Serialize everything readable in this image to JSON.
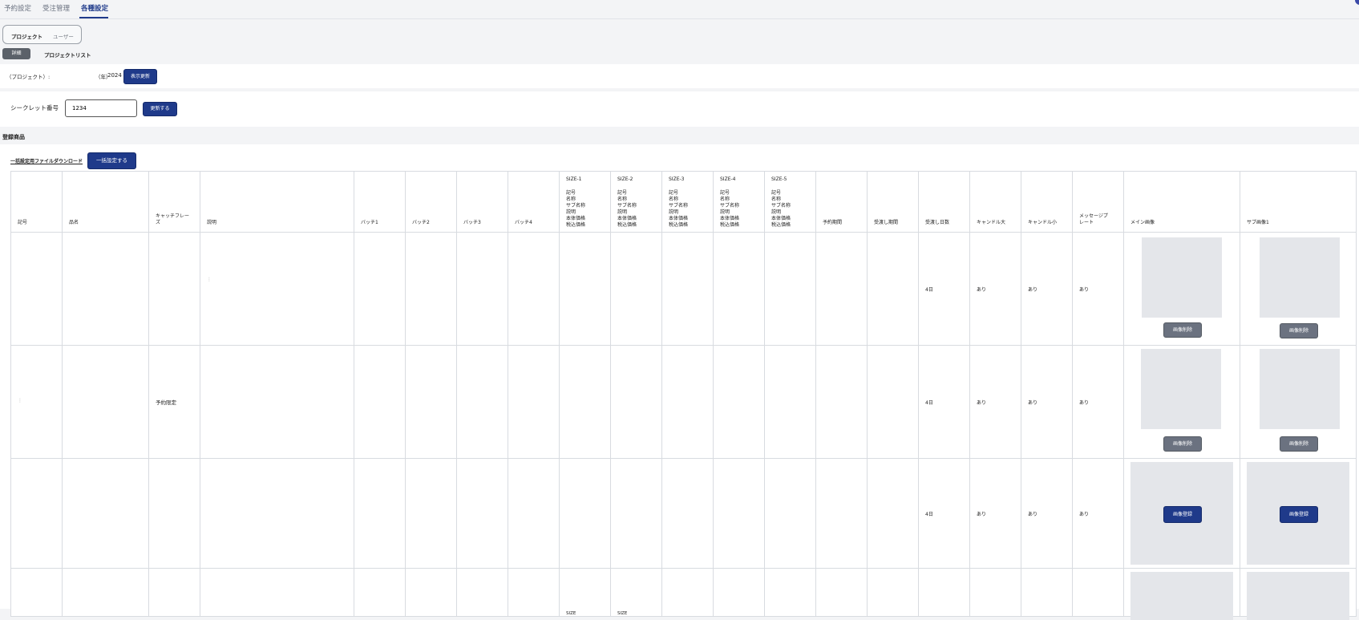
{
  "top_tabs": [
    "予約設定",
    "受注管理",
    "各種設定"
  ],
  "sub_tabs": [
    "プロジェクト",
    "ユーザー"
  ],
  "detail_tabs": [
    "詳細",
    "プロジェクトリスト"
  ],
  "project_row": {
    "label": "（プロジェクト）:",
    "year_prefix": "（年）",
    "year": "2024",
    "refresh_button": "表示更新"
  },
  "secret": {
    "label": "シークレット番号",
    "value": "1234",
    "update_button": "更新する"
  },
  "registered": {
    "title": "登録商品",
    "download_link": "一括設定用ファイルダウンロード",
    "bulk_button": "一括設定する"
  },
  "table": {
    "headers": [
      "記号",
      "品名",
      "キャッチフレーズ",
      "説明",
      "バッチ1",
      "バッチ2",
      "バッチ3",
      "バッチ4",
      "SIZE-1",
      "SIZE-2",
      "SIZE-3",
      "SIZE-4",
      "SIZE-5",
      "予約期間",
      "受渡し期間",
      "受渡し日数",
      "キャンドル大",
      "キャンドル小",
      "メッセージプレート",
      "メイン画像",
      "サブ画像1"
    ],
    "size_fields": [
      "記号",
      "名称",
      "サブ名称",
      "説明",
      "本体価格",
      "税込価格"
    ],
    "rows": [
      {
        "catch": "",
        "days": "4日",
        "candle_l": "あり",
        "candle_s": "あり",
        "message": "あり",
        "main_btn": "画像削除",
        "sub_btn": "画像削除"
      },
      {
        "catch": "予約限定",
        "days": "4日",
        "candle_l": "あり",
        "candle_s": "あり",
        "message": "あり",
        "main_btn": "画像削除",
        "sub_btn": "画像削除"
      },
      {
        "catch": "",
        "days": "4日",
        "candle_l": "あり",
        "candle_s": "あり",
        "message": "あり",
        "main_btn": "画像登録",
        "sub_btn": "画像登録"
      },
      {
        "catch": "",
        "days": "",
        "candle_l": "",
        "candle_s": "",
        "message": "",
        "size1": "SIZE",
        "size2": "SIZE"
      }
    ]
  }
}
